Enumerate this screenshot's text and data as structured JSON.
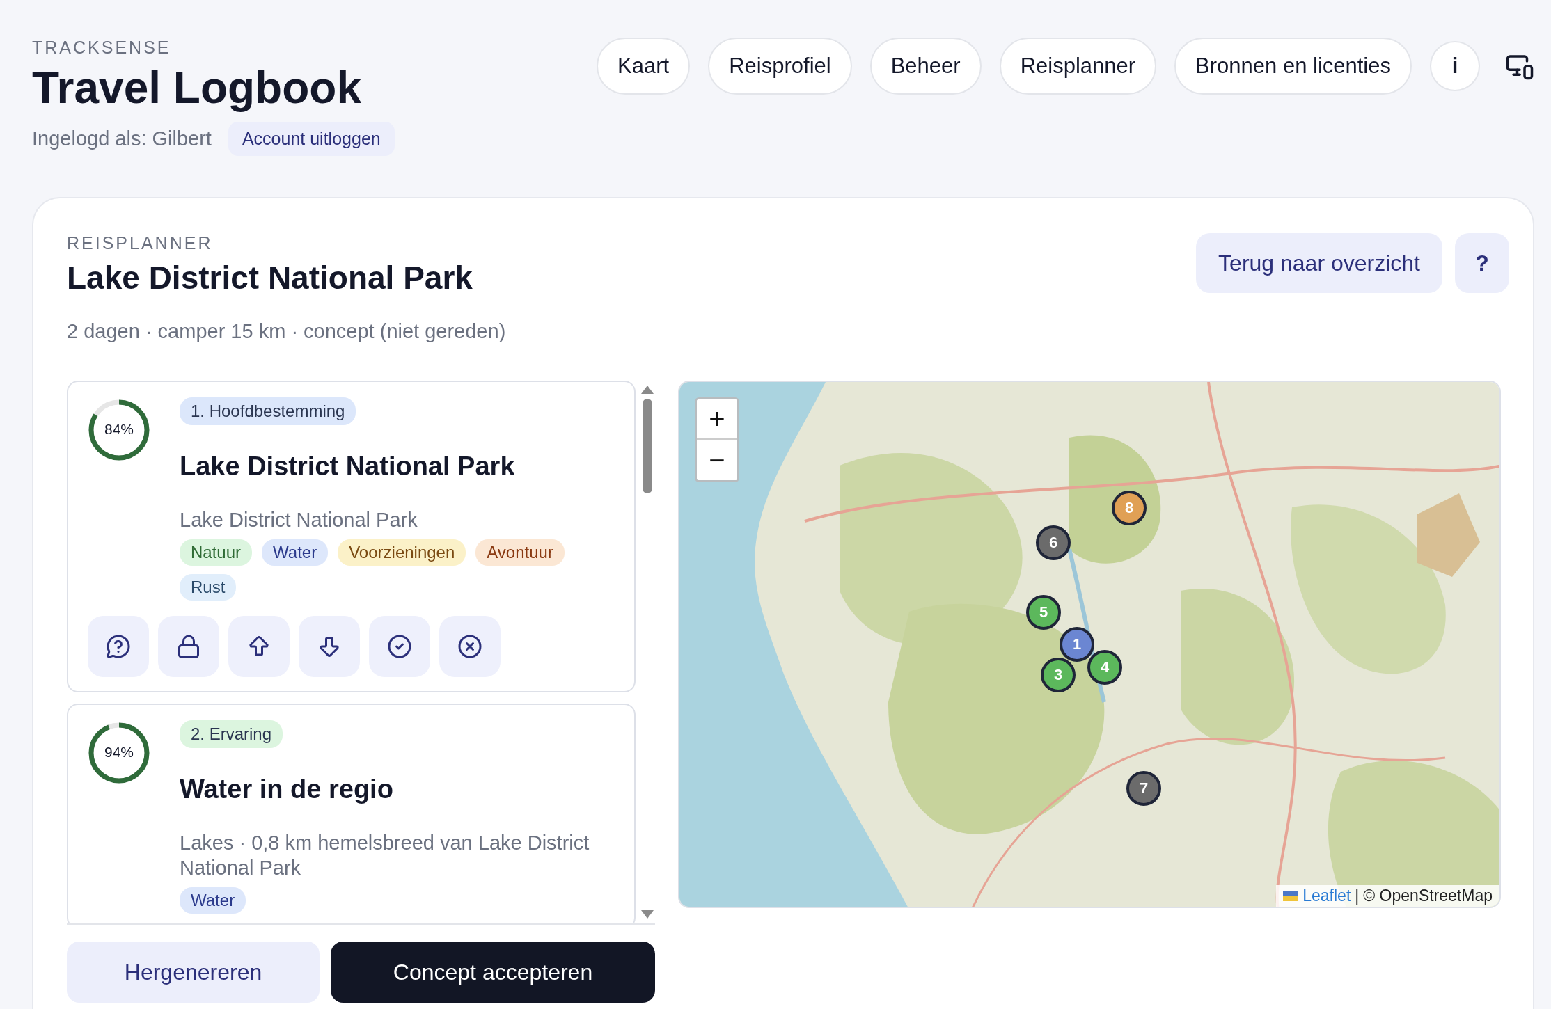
{
  "app": {
    "brand": "TRACKSENSE",
    "title": "Travel Logbook",
    "user_label": "Ingelogd als: Gilbert",
    "logout": "Account uitloggen"
  },
  "nav": [
    {
      "label": "Kaart",
      "kind": "pill"
    },
    {
      "label": "Reisprofiel",
      "kind": "pill"
    },
    {
      "label": "Beheer",
      "kind": "pill"
    },
    {
      "label": "Reisplanner",
      "kind": "pill"
    },
    {
      "label": "Bronnen en licenties",
      "kind": "pill"
    },
    {
      "label": "i",
      "kind": "circle"
    }
  ],
  "planner": {
    "eyebrow": "REISPLANNER",
    "title": "Lake District National Park",
    "meta": "2 dagen · camper 15 km · concept (niet gereden)",
    "back_button": "Terug naar overzicht",
    "help_button": "?"
  },
  "stops": [
    {
      "score": "84%",
      "level": 0.84,
      "badge": {
        "label": "1. Hoofdbestemming",
        "color": "#dce7fb"
      },
      "title": "Lake District National Park",
      "subtitle": "Lake District National Park",
      "tags": [
        {
          "label": "Natuur",
          "color": "#dcf5df"
        },
        {
          "label": "Water",
          "color": "#dde7fb"
        },
        {
          "label": "Voorzieningen",
          "color": "#fbf1c8"
        },
        {
          "label": "Avontuur",
          "color": "#fbe7d4"
        },
        {
          "label": "Rust",
          "color": "#e1eefb"
        }
      ],
      "has_actions": true
    },
    {
      "score": "94%",
      "level": 0.94,
      "badge": {
        "label": "2. Ervaring",
        "color": "#dcf5df"
      },
      "title": "Water in de regio",
      "subtitle": "Lakes · 0,8 km hemelsbreed van Lake District National Park",
      "tags": [
        {
          "label": "Water",
          "color": "#dde7fb"
        }
      ]
    }
  ],
  "footer": {
    "regenerate": "Hergenereren",
    "accept": "Concept accepteren"
  },
  "map": {
    "zoom_in": "+",
    "zoom_out": "−",
    "markers": [
      {
        "label": "8",
        "color": "#e0a055"
      },
      {
        "label": "6",
        "color": "#6b6b6b"
      },
      {
        "label": "5",
        "color": "#5cb85c"
      },
      {
        "label": "1",
        "color": "#6b86d2"
      },
      {
        "label": "3",
        "color": "#5cb85c"
      },
      {
        "label": "4",
        "color": "#5cb85c"
      },
      {
        "label": "7",
        "color": "#6b6b6b"
      }
    ],
    "attribution": {
      "link": "Leaflet",
      "separator": "|",
      "text": "© OpenStreetMap"
    }
  }
}
